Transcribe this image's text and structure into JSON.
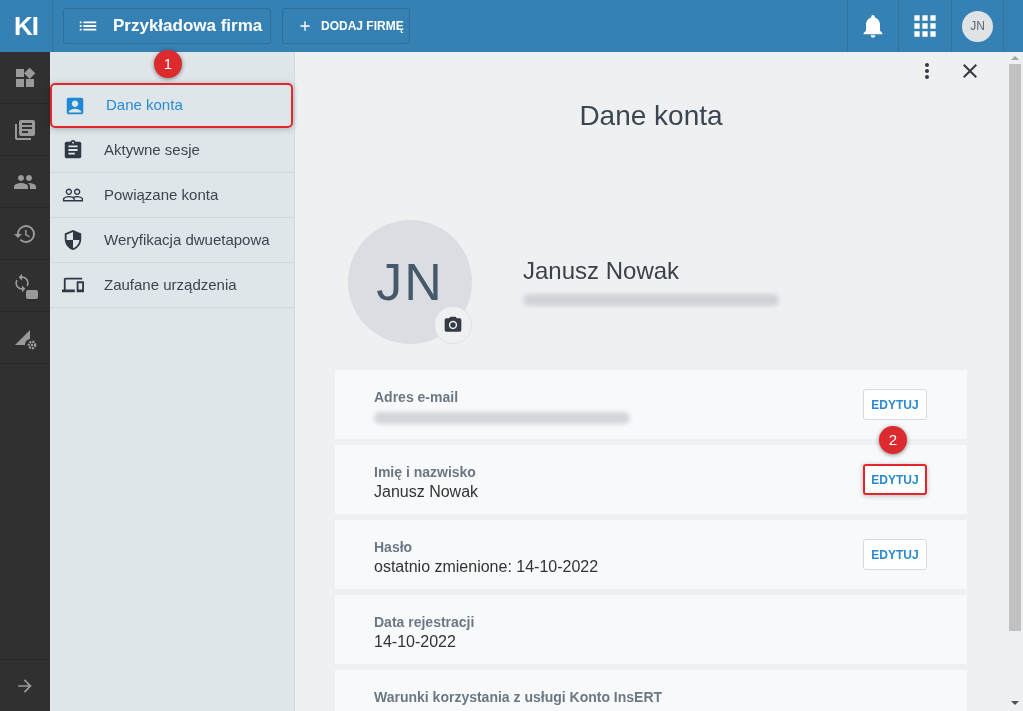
{
  "topbar": {
    "logo": "KI",
    "company_button": {
      "label": "Przykładowa firma"
    },
    "add_button": {
      "label": "DODAJ FIRMĘ"
    },
    "avatar": {
      "initials": "JN"
    }
  },
  "sidebar": {
    "items": [
      {
        "label": "Dane konta",
        "selected": true,
        "highlighted": true,
        "callout": "1"
      },
      {
        "label": "Aktywne sesje",
        "selected": false,
        "highlighted": false
      },
      {
        "label": "Powiązane konta",
        "selected": false,
        "highlighted": false
      },
      {
        "label": "Weryfikacja dwuetapowa",
        "selected": false,
        "highlighted": false
      },
      {
        "label": "Zaufane urządzenia",
        "selected": false,
        "highlighted": false
      }
    ]
  },
  "panel": {
    "title": "Dane konta",
    "profile": {
      "initials": "JN",
      "name": "Janusz Nowak"
    },
    "fields": [
      {
        "label": "Adres e-mail",
        "kind": "blurred",
        "button": {
          "label": "EDYTUJ",
          "highlighted": false
        }
      },
      {
        "label": "Imię i nazwisko",
        "kind": "text",
        "value": "Janusz Nowak",
        "button": {
          "label": "EDYTUJ",
          "highlighted": true,
          "callout": "2"
        }
      },
      {
        "label": "Hasło",
        "kind": "text",
        "value": "ostatnio zmienione: 14-10-2022",
        "button": {
          "label": "EDYTUJ",
          "highlighted": false
        }
      },
      {
        "label": "Data rejestracji",
        "kind": "text",
        "value": "14-10-2022"
      },
      {
        "label": "Warunki korzystania z usługi Konto InsERT",
        "kind": "label_only"
      }
    ]
  }
}
